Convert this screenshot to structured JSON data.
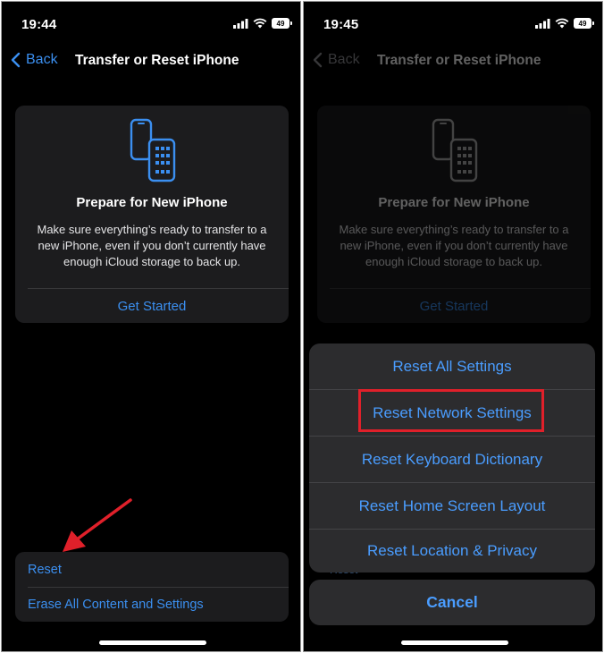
{
  "colors": {
    "accent": "#3b8ff0",
    "highlight": "#e0202a",
    "arrow": "#e0202a"
  },
  "left": {
    "status": {
      "time": "19:44",
      "battery": "49"
    },
    "nav": {
      "back_label": "Back",
      "title": "Transfer or Reset iPhone"
    },
    "card": {
      "title": "Prepare for New iPhone",
      "description": "Make sure everything’s ready to transfer to a new iPhone, even if you don’t currently have enough iCloud storage to back up.",
      "action": "Get Started"
    },
    "reset_group": {
      "reset_label": "Reset",
      "erase_label": "Erase All Content and Settings"
    }
  },
  "right": {
    "status": {
      "time": "19:45",
      "battery": "49"
    },
    "nav": {
      "back_label": "Back",
      "title": "Transfer or Reset iPhone"
    },
    "card": {
      "title": "Prepare for New iPhone",
      "description": "Make sure everything’s ready to transfer to a new iPhone, even if you don’t currently have enough iCloud storage to back up.",
      "action": "Get Started"
    },
    "peek_label": "Reset",
    "sheet": {
      "items": [
        "Reset All Settings",
        "Reset Network Settings",
        "Reset Keyboard Dictionary",
        "Reset Home Screen Layout",
        "Reset Location & Privacy"
      ],
      "cancel": "Cancel"
    }
  }
}
